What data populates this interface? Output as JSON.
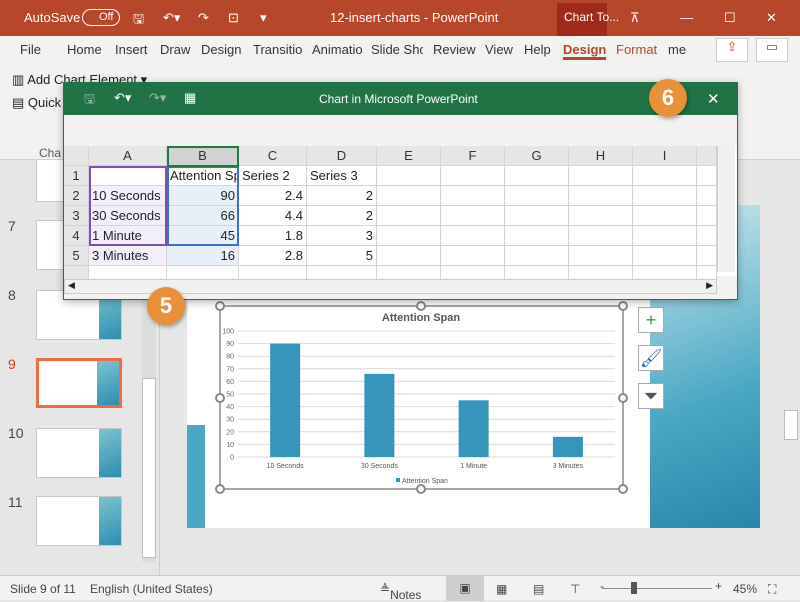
{
  "titlebar": {
    "autosave": "AutoSave",
    "toggle": "Off",
    "title": "12-insert-charts  -  PowerPoint",
    "context_tab": "Chart To..."
  },
  "tabs": [
    "File",
    "Home",
    "Insert",
    "Draw",
    "Design",
    "Transitio",
    "Animatio",
    "Slide Sho",
    "Review",
    "View",
    "Help",
    "Design",
    "Format",
    "me"
  ],
  "ribbon": {
    "add_chart_element": "Add Chart Element",
    "quick": "Quick",
    "group": "Cha"
  },
  "slides": {
    "numbers": [
      "7",
      "8",
      "9",
      "10",
      "11"
    ],
    "current": "9"
  },
  "dialog": {
    "title": "Chart in Microsoft PowerPoint",
    "columns": [
      "A",
      "B",
      "C",
      "D",
      "E",
      "F",
      "G",
      "H",
      "I"
    ],
    "rows": [
      [
        "",
        "Attention Span",
        "Series 2",
        "Series 3"
      ],
      [
        "10 Seconds",
        "90",
        "2.4",
        "2"
      ],
      [
        "30 Seconds",
        "66",
        "4.4",
        "2"
      ],
      [
        "1 Minute",
        "45",
        "1.8",
        "3"
      ],
      [
        "3 Minutes",
        "16",
        "2.8",
        "5"
      ]
    ]
  },
  "badges": {
    "five": "5",
    "six": "6"
  },
  "chart_data": {
    "type": "bar",
    "title": "Attention Span",
    "categories": [
      "10 Seconds",
      "30 Seconds",
      "1 Minute",
      "3 Minutes"
    ],
    "series": [
      {
        "name": "Attention Span",
        "values": [
          90,
          66,
          45,
          16
        ]
      }
    ],
    "ylim": [
      0,
      100
    ],
    "yticks": [
      "0",
      "10",
      "20",
      "30",
      "40",
      "50",
      "60",
      "70",
      "80",
      "90",
      "100"
    ],
    "grid": true,
    "legend": "bottom",
    "color": "#3795bc"
  },
  "status": {
    "slide": "Slide 9 of 11",
    "language": "English (United States)",
    "notes": "Notes",
    "zoom": "45%"
  },
  "colors": {
    "accent": "#b7472a",
    "excel": "#217346"
  }
}
